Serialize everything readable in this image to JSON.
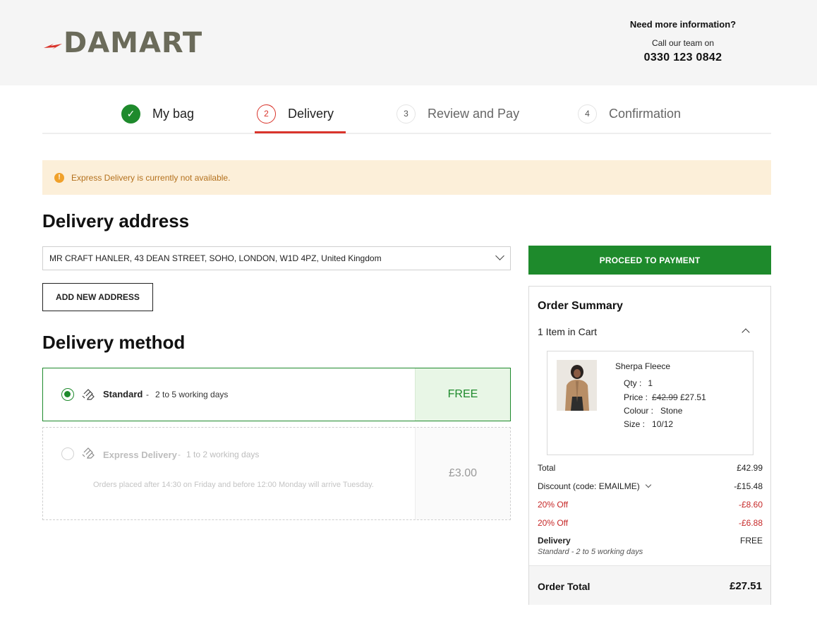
{
  "header": {
    "brand": "DAMART",
    "help_title": "Need more information?",
    "help_sub": "Call our team on",
    "help_phone": "0330 123 0842"
  },
  "steps": [
    {
      "number": "✓",
      "label": "My bag",
      "state": "done"
    },
    {
      "number": "2",
      "label": "Delivery",
      "state": "active"
    },
    {
      "number": "3",
      "label": "Review and Pay",
      "state": "upcoming"
    },
    {
      "number": "4",
      "label": "Confirmation",
      "state": "upcoming"
    }
  ],
  "alert": {
    "icon": "info-icon",
    "text": "Express Delivery is currently not available."
  },
  "delivery_address": {
    "heading": "Delivery address",
    "selected": "MR CRAFT HANLER, 43 DEAN STREET, SOHO, LONDON, W1D 4PZ, United Kingdom",
    "add_button": "ADD NEW ADDRESS"
  },
  "delivery_method": {
    "heading": "Delivery method",
    "options": [
      {
        "name": "Standard",
        "separator": "-",
        "days": "2 to 5 working days",
        "price": "FREE",
        "selected": true,
        "enabled": true
      },
      {
        "name": "Express Delivery",
        "separator": "-",
        "days": "1 to 2 working days",
        "price": "£3.00",
        "selected": false,
        "enabled": false,
        "note": "Orders placed after 14:30 on Friday and before 12:00 Monday will arrive Tuesday."
      }
    ]
  },
  "summary": {
    "proceed_button": "PROCEED TO PAYMENT",
    "title": "Order Summary",
    "count": "1 Item in Cart",
    "item": {
      "name": "Sherpa Fleece",
      "qty_label": "Qty :",
      "qty": "1",
      "price_label": "Price :",
      "price_old": "£42.99",
      "price_new": "£27.51",
      "colour_label": "Colour :",
      "colour": "Stone",
      "size_label": "Size :",
      "size": "10/12"
    },
    "total_label": "Total",
    "total_value": "£42.99",
    "discount_label": "Discount (code: EMAILME)",
    "discount_value": "-£15.48",
    "promos": [
      {
        "label": "20% Off",
        "value": "-£8.60"
      },
      {
        "label": "20% Off",
        "value": "-£6.88"
      }
    ],
    "delivery_label": "Delivery",
    "delivery_value": "FREE",
    "delivery_sub": "Standard - 2 to 5 working days",
    "order_total_label": "Order Total",
    "order_total_value": "£27.51"
  },
  "colors": {
    "accent_green": "#1e8a2c",
    "accent_red": "#d9342b",
    "alert_bg": "#fcefd9"
  }
}
